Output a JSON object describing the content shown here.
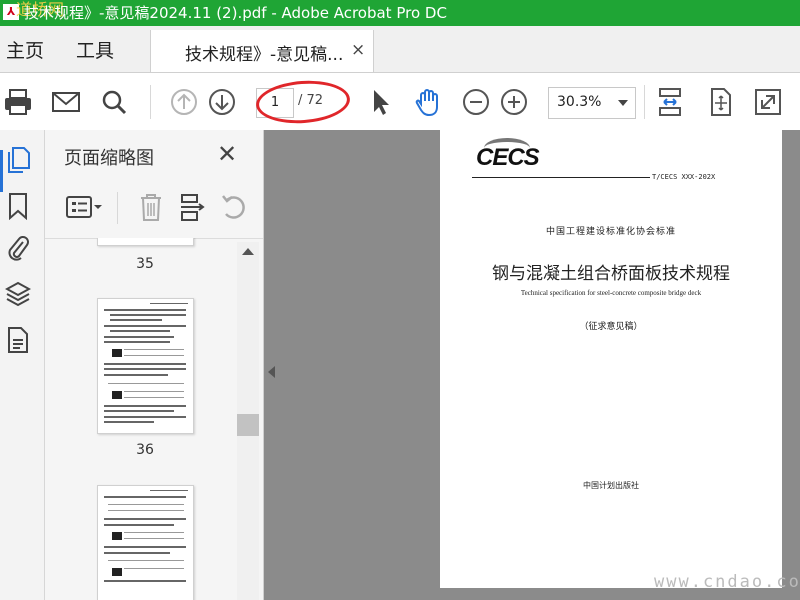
{
  "window": {
    "title": "技术规程》-意见稿2024.11 (2).pdf - Adobe Acrobat Pro DC",
    "title_bar_color": "#1fa535",
    "app_icon": "acrobat-icon",
    "watermark_text": "道桥网"
  },
  "nav": {
    "home_tab": "主页",
    "tools_tab": "工具",
    "doc_tab_label": "技术规程》-意见稿...",
    "doc_tab_close": "×"
  },
  "toolbar": {
    "icons": [
      "print-icon",
      "email-icon",
      "search-icon",
      "prev-page-icon",
      "next-page-icon",
      "select-arrow-icon",
      "hand-icon",
      "zoom-out-icon",
      "zoom-in-icon",
      "fit-page-icon",
      "full-screen-icon",
      "expand-icon"
    ],
    "current_page": "1",
    "total_pages": "/ 72",
    "zoom": "30.3%",
    "annotation_color": "#e0262a",
    "accent_color": "#2672d6"
  },
  "sidebar": {
    "rail_icons": [
      "page-thumbnails-icon",
      "bookmark-icon",
      "attachment-icon",
      "layers-icon",
      "document-properties-icon"
    ],
    "panel_title": "页面缩略图",
    "close_label": "✕",
    "tools": [
      "thumbnail-options-icon",
      "delete-page-icon",
      "insert-page-icon",
      "rotate-icon"
    ],
    "thumbnails": [
      {
        "label": "35"
      },
      {
        "label": "36"
      }
    ]
  },
  "document": {
    "logo": "CECS",
    "standard_number": "T/CECS XXX-202X",
    "organization": "中国工程建设标准化协会标准",
    "title": "钢与混凝土组合桥面板技术规程",
    "english_title": "Technical specification for steel-concrete composite bridge deck",
    "draft_note": "（征求意见稿）",
    "publisher": "中国计划出版社"
  },
  "site_watermark": "www.cndao.com"
}
